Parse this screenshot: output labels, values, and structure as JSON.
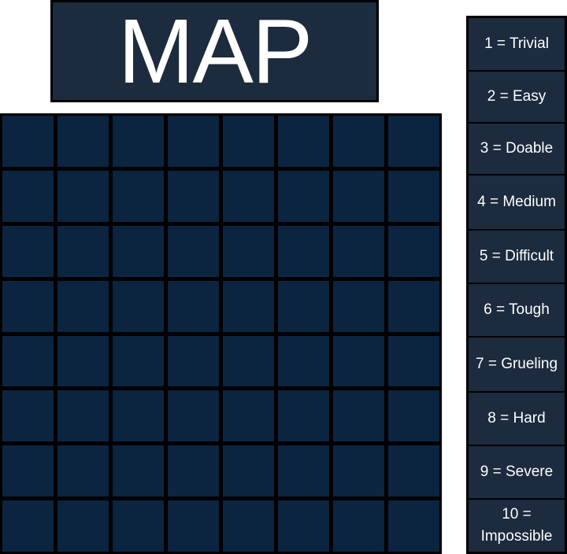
{
  "title": "MAP",
  "colors": {
    "title_bg": "#1c2b3e",
    "cell_bg": "#0b2540",
    "legend_bg": "#1c2b3e",
    "border": "#000000",
    "text": "#ffffff"
  },
  "grid": {
    "rows": 8,
    "cols": 8
  },
  "legend": [
    "1 = Trivial",
    "2 = Easy",
    "3 = Doable",
    "4 = Medium",
    "5 = Difficult",
    "6 = Tough",
    "7 = Grueling",
    "8 = Hard",
    "9 = Severe",
    "10 = Impossible"
  ]
}
